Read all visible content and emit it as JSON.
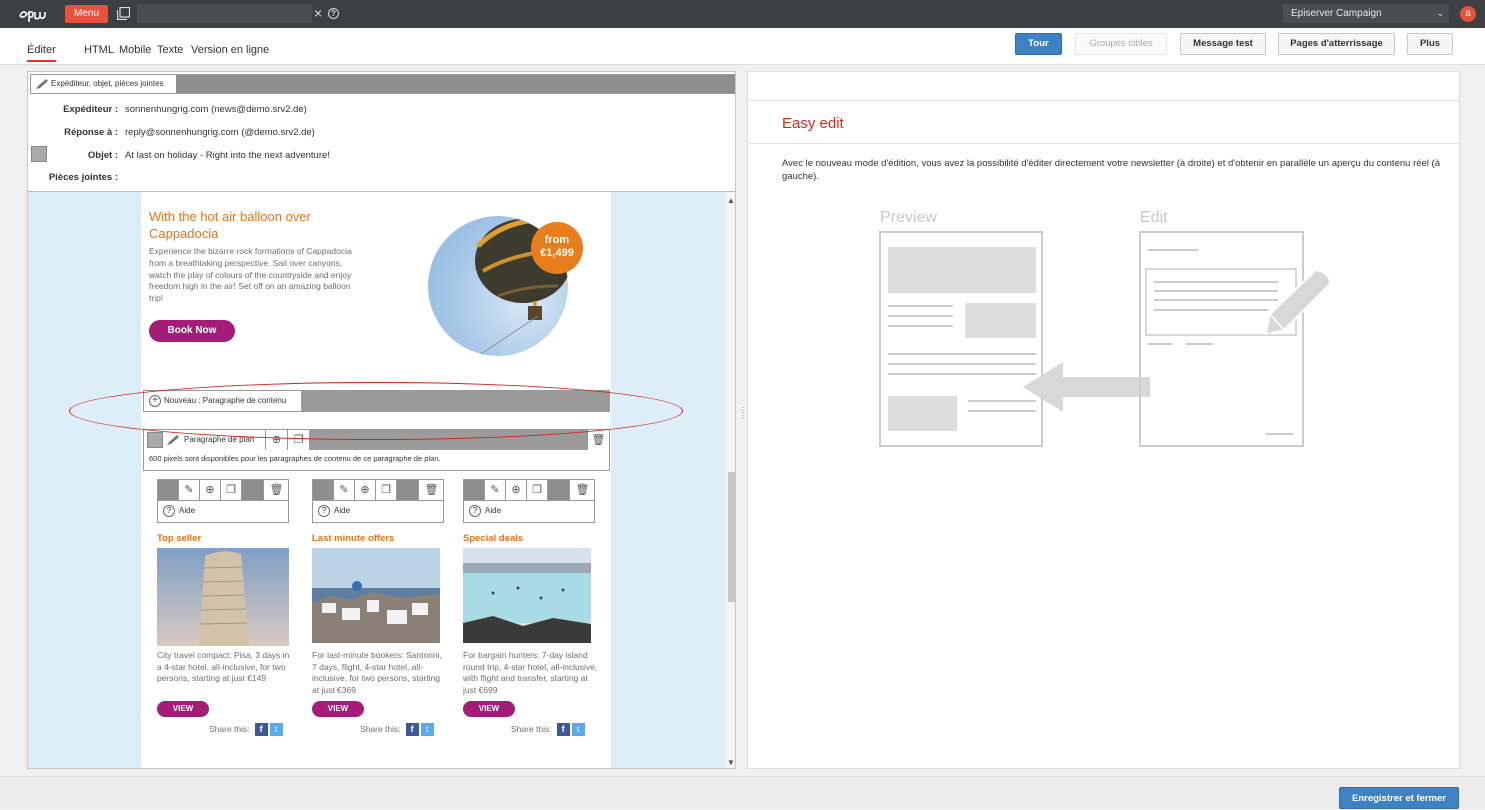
{
  "topbar": {
    "menu_label": "Menu",
    "search_value": "",
    "app_select": "Episerver Campaign",
    "user_initial": "a"
  },
  "mode_tabs": [
    "Éditer",
    "HTML",
    "Mobile",
    "Texte",
    "Version en ligne"
  ],
  "toolbar": {
    "tour": "Tour",
    "target_groups": "Groupes cibles",
    "test_message": "Message test",
    "landing_pages": "Pages d'atterrissage",
    "more": "Plus"
  },
  "header": {
    "editbar_label": "Expéditeur, objet, pièces jointes",
    "rows": [
      {
        "key": "Expéditeur :",
        "value": "sonnenhungrig.com (news@demo.srv2.de)"
      },
      {
        "key": "Réponse à :",
        "value": "reply@sonnenhungrig.com (@demo.srv2.de)"
      },
      {
        "key": "Objet :",
        "value": "At last on holiday - Right into the next adventure!"
      },
      {
        "key": "Pièces jointes :",
        "value": ""
      }
    ]
  },
  "article": {
    "title": "With the hot air balloon over Cappadocia",
    "text": "Experience the bizarre rock formations of Cappadocia from a breathtaking perspective. Sail over canyons, watch the play of colours of the countryside and enjoy freedom high in the air! Set off on an amazing balloon trip!",
    "button": "Book Now",
    "price_from": "from",
    "price": "€1,499"
  },
  "new_paragraph": "Nouveau : Paragraphe de contenu",
  "plan_paragraph": {
    "label": "Paragraphe de plan",
    "info": "600 pixels sont disponibles pour les paragraphes de contenu de ce paragraphe de plan."
  },
  "help_label": "Aide",
  "columns": [
    {
      "title": "Top seller",
      "text": "City travel compact: Pisa, 3 days in a 4-star hotel, all-inclusive, for two persons, starting at just €149",
      "button": "VIEW",
      "share": "Share this:"
    },
    {
      "title": "Last minute offers",
      "text": "For last-minute bookers: Santorini, 7 days, flight, 4-star hotel, all-inclusive, for two persons, starting at just €369",
      "button": "VIEW",
      "share": "Share this:"
    },
    {
      "title": "Special deals",
      "text": "For bargain hunters: 7-day island round trip, 4-star hotel, all-inclusive, with flight and transfer, starting at just €699",
      "button": "VIEW",
      "share": "Share this:"
    }
  ],
  "right": {
    "title": "Easy edit",
    "description": "Avec le nouveau mode d'édition, vous avez la possibilité d'éditer directement votre newsletter (à droite) et d'obtenir en parallèle un aperçu du contenu réel (à gauche).",
    "preview_label": "Preview",
    "edit_label": "Edit"
  },
  "footer": {
    "save_close": "Enregistrer et fermer"
  },
  "colors": {
    "accent_red": "#e8513a",
    "primary_blue": "#3d82c4",
    "orange": "#e07418",
    "magenta": "#a41b78"
  }
}
